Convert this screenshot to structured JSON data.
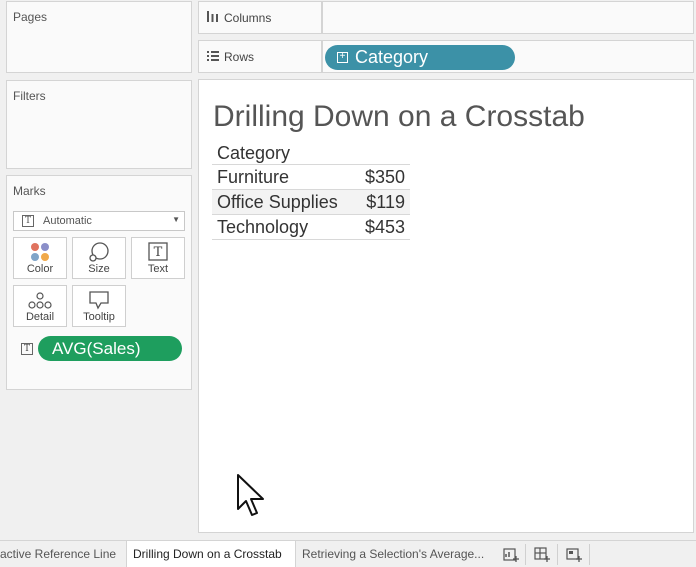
{
  "side": {
    "pages_title": "Pages",
    "filters_title": "Filters",
    "marks_title": "Marks",
    "mark_type": "Automatic",
    "mark_buttons": {
      "color": "Color",
      "size": "Size",
      "text": "Text",
      "detail": "Detail",
      "tooltip": "Tooltip"
    },
    "measure_pill": "AVG(Sales)"
  },
  "shelves": {
    "columns_label": "Columns",
    "rows_label": "Rows",
    "rows_pill": "Category"
  },
  "view": {
    "title": "Drilling Down on a Crosstab",
    "header": "Category",
    "rows": [
      {
        "category": "Furniture",
        "value": "$350"
      },
      {
        "category": "Office Supplies",
        "value": "$119"
      },
      {
        "category": "Technology",
        "value": "$453"
      }
    ]
  },
  "tabs": [
    {
      "label": "active Reference Line"
    },
    {
      "label": "Drilling Down on a Crosstab"
    },
    {
      "label": "Retrieving a Selection's Average..."
    }
  ],
  "colors": {
    "green_pill": "#1e9e5e",
    "blue_pill": "#3c91a7"
  }
}
